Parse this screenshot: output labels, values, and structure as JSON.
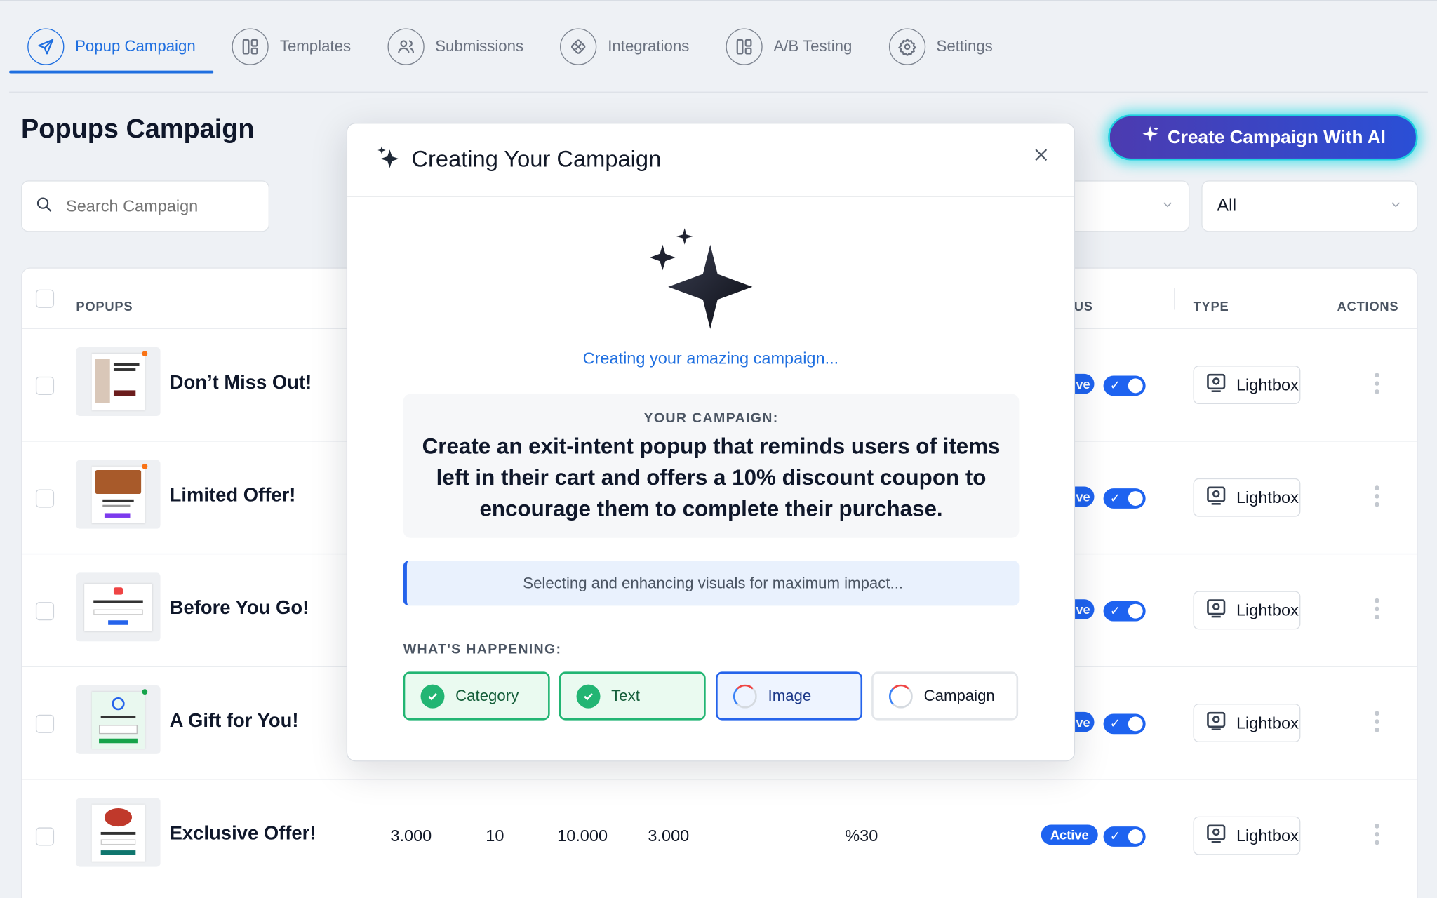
{
  "nav": {
    "tabs": [
      {
        "label": "Popup Campaign",
        "icon": "send-icon",
        "active": true
      },
      {
        "label": "Templates",
        "icon": "layout-icon"
      },
      {
        "label": "Submissions",
        "icon": "users-icon"
      },
      {
        "label": "Integrations",
        "icon": "puzzle-icon"
      },
      {
        "label": "A/B Testing",
        "icon": "split-layout-icon"
      },
      {
        "label": "Settings",
        "icon": "gear-icon"
      }
    ]
  },
  "header": {
    "title": "Popups Campaign",
    "ai_button_label": "Create Campaign With AI"
  },
  "filters": {
    "search_placeholder": "Search Campaign",
    "type_filter_value": "All"
  },
  "table": {
    "headers": {
      "popups": "POPUPS",
      "status_partial": "US",
      "type": "TYPE",
      "actions": "ACTIONS"
    },
    "rows": [
      {
        "name": "Don’t Miss Out!",
        "status_partial": "ve",
        "type": "Lightbox"
      },
      {
        "name": "Limited Offer!",
        "status_partial": "ve",
        "type": "Lightbox"
      },
      {
        "name": "Before You Go!",
        "status_partial": "ve",
        "type": "Lightbox"
      },
      {
        "name": "A Gift for You!",
        "status_partial": "ve",
        "type": "Lightbox"
      },
      {
        "name": "Exclusive Offer!",
        "views": "3.000",
        "clicks": "10",
        "impressions": "10.000",
        "conversions": "3.000",
        "rate": "%30",
        "status": "Active",
        "type": "Lightbox"
      }
    ]
  },
  "modal": {
    "title": "Creating Your Campaign",
    "status": "Creating your amazing campaign...",
    "campaign_label": "YOUR CAMPAIGN:",
    "campaign_text": "Create an exit-intent popup that reminds users of items left in their cart and offers a 10% discount coupon to encourage them to complete their purchase.",
    "progress_message": "Selecting and enhancing visuals for maximum impact...",
    "happening_label": "WHAT'S HAPPENING:",
    "steps": [
      {
        "label": "Category",
        "state": "done"
      },
      {
        "label": "Text",
        "state": "done"
      },
      {
        "label": "Image",
        "state": "active"
      },
      {
        "label": "Campaign",
        "state": "pending"
      }
    ]
  },
  "colors": {
    "accent": "#1f6fe0",
    "success": "#22b573",
    "toggle": "#1e63f0"
  }
}
